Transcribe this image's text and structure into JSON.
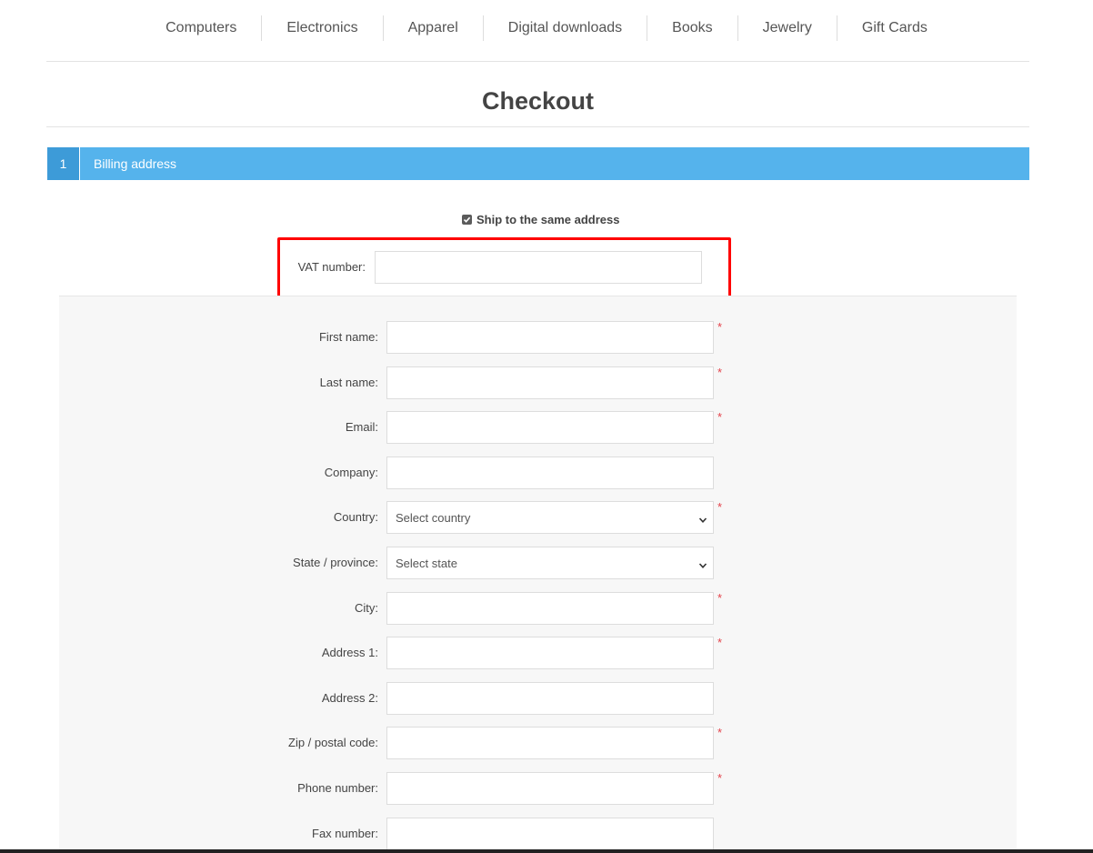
{
  "nav": {
    "items": [
      "Computers",
      "Electronics",
      "Apparel",
      "Digital downloads",
      "Books",
      "Jewelry",
      "Gift Cards"
    ]
  },
  "page": {
    "title": "Checkout"
  },
  "step": {
    "number": "1",
    "title": "Billing address"
  },
  "ship_same": {
    "label": "Ship to the same address",
    "checked": true
  },
  "vat": {
    "label": "VAT number:",
    "value": ""
  },
  "form": {
    "fields": [
      {
        "label": "First name:",
        "type": "text",
        "value": "",
        "required": true
      },
      {
        "label": "Last name:",
        "type": "text",
        "value": "",
        "required": true
      },
      {
        "label": "Email:",
        "type": "text",
        "value": "",
        "required": true
      },
      {
        "label": "Company:",
        "type": "text",
        "value": "",
        "required": false
      },
      {
        "label": "Country:",
        "type": "select",
        "value": "Select country",
        "required": true
      },
      {
        "label": "State / province:",
        "type": "select",
        "value": "Select state",
        "required": false
      },
      {
        "label": "City:",
        "type": "text",
        "value": "",
        "required": true
      },
      {
        "label": "Address 1:",
        "type": "text",
        "value": "",
        "required": true
      },
      {
        "label": "Address 2:",
        "type": "text",
        "value": "",
        "required": false
      },
      {
        "label": "Zip / postal code:",
        "type": "text",
        "value": "",
        "required": true
      },
      {
        "label": "Phone number:",
        "type": "text",
        "value": "",
        "required": true
      },
      {
        "label": "Fax number:",
        "type": "text",
        "value": "",
        "required": false
      }
    ],
    "required_marker": "*"
  },
  "colors": {
    "step_bar": "#55b3ec",
    "step_number_bg": "#3d9bd8",
    "highlight_border": "#ff0000",
    "required": "#e4434b"
  }
}
